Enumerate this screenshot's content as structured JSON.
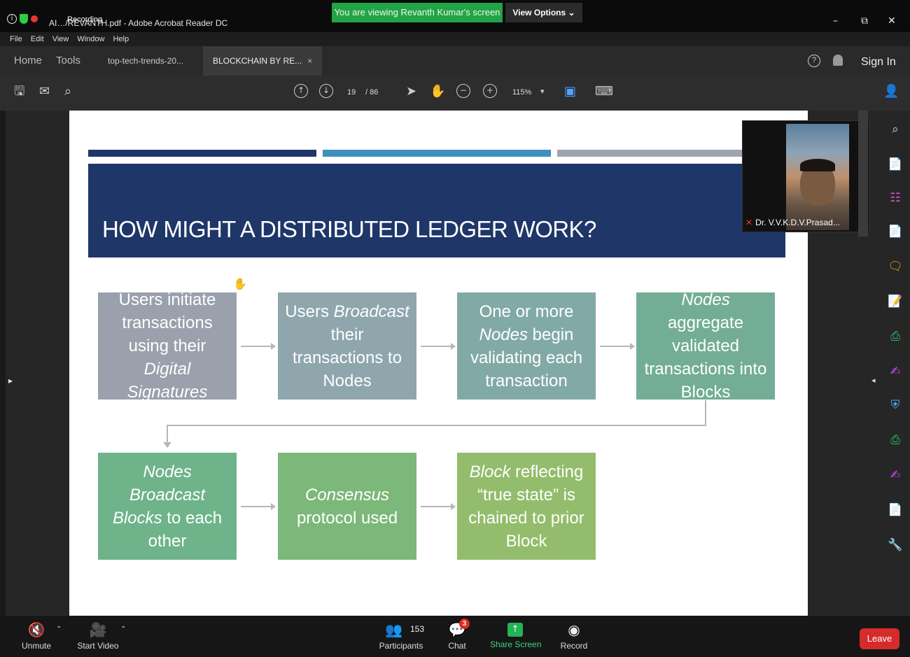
{
  "window": {
    "title": "AI…/REVANTH.pdf - Adobe Acrobat Reader DC",
    "recording_label": "Recording",
    "share_banner": "You are viewing Revanth Kumar's screen",
    "view_options": "View Options",
    "minimize": "–",
    "restore": "⧉",
    "close": "✕"
  },
  "menu": [
    "File",
    "Edit",
    "View",
    "Window",
    "Help"
  ],
  "tabs": {
    "home": "Home",
    "tools": "Tools",
    "doc1": "top-tech-trends-20...",
    "doc2": "BLOCKCHAIN BY RE...",
    "close_glyph": "×",
    "sign_in": "Sign In"
  },
  "toolbar": {
    "page_current": "19",
    "page_total": "/ 86",
    "zoom": "115%"
  },
  "slide": {
    "title": "HOW MIGHT A DISTRIBUTED LEDGER WORK?",
    "top_bar_colors": [
      "#1e3668",
      "#3f8fbf",
      "#9ea4ae"
    ],
    "steps": [
      {
        "pre": "Users initiate transactions using their ",
        "em": "Digital Signatures",
        "post": "",
        "color": "#9aa1ad"
      },
      {
        "pre": "Users ",
        "em": "Broadcast",
        "post": " their transactions to Nodes",
        "color": "#8fa6ad"
      },
      {
        "pre": "One or more ",
        "em": "Nodes",
        "post": " begin validating each transaction",
        "color": "#81aaa7"
      },
      {
        "pre": "",
        "em": "Nodes",
        "post": " aggregate validated transactions into Blocks",
        "color": "#73ad96"
      },
      {
        "pre": "",
        "em": "Nodes Broadcast Blocks",
        "post": " to each other",
        "color": "#6fb38a"
      },
      {
        "pre": "",
        "em": "Consensus",
        "post": " protocol used",
        "color": "#7cb879"
      },
      {
        "pre": "",
        "em": "Block",
        "post": " reflecting “true state” is chained to prior Block",
        "color": "#93bd6c"
      }
    ]
  },
  "video": {
    "participant_name": "Dr. V.V.K.D.V.Prasad..."
  },
  "zoom_bar": {
    "unmute": "Unmute",
    "start_video": "Start Video",
    "participants_count": "153",
    "participants": "Participants",
    "chat": "Chat",
    "chat_badge": "3",
    "share_screen": "Share Screen",
    "record": "Record",
    "leave": "Leave"
  },
  "colors": {
    "share_green": "#23a347",
    "leave_red": "#d62b2b",
    "title_navy": "#1e3668"
  }
}
